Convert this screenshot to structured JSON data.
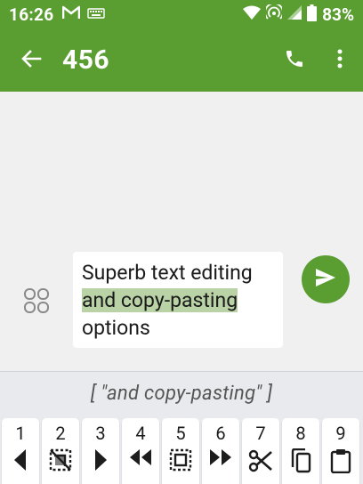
{
  "status_bar": {
    "time": "16:26",
    "battery": "83%",
    "icons": [
      "gmail-icon",
      "keyboard-icon",
      "wifi-icon",
      "hotspot-icon",
      "signal-icon",
      "battery-icon"
    ]
  },
  "app_bar": {
    "title": "456",
    "actions": [
      "back-arrow-icon",
      "phone-icon",
      "more-vert-icon"
    ]
  },
  "compose": {
    "text_before": "Superb text editing",
    "text_selected": "and copy-pasting",
    "text_after": "options",
    "emoji_icon": "emoji-grid-icon",
    "send_icon": "send-icon"
  },
  "keyboard": {
    "clipboard_preview": "[ \"and copy-pasting\" ]",
    "keys": [
      {
        "number": "1",
        "icon": "cursor-left-icon"
      },
      {
        "number": "2",
        "icon": "deselect-icon"
      },
      {
        "number": "3",
        "icon": "cursor-right-icon"
      },
      {
        "number": "4",
        "icon": "word-left-icon"
      },
      {
        "number": "5",
        "icon": "select-all-icon"
      },
      {
        "number": "6",
        "icon": "word-right-icon"
      },
      {
        "number": "7",
        "icon": "cut-icon"
      },
      {
        "number": "8",
        "icon": "copy-icon"
      },
      {
        "number": "9",
        "icon": "paste-icon"
      }
    ]
  },
  "colors": {
    "accent": "#5a9e32",
    "selection": "#b9d3a7",
    "background": "#f0f0f0"
  }
}
